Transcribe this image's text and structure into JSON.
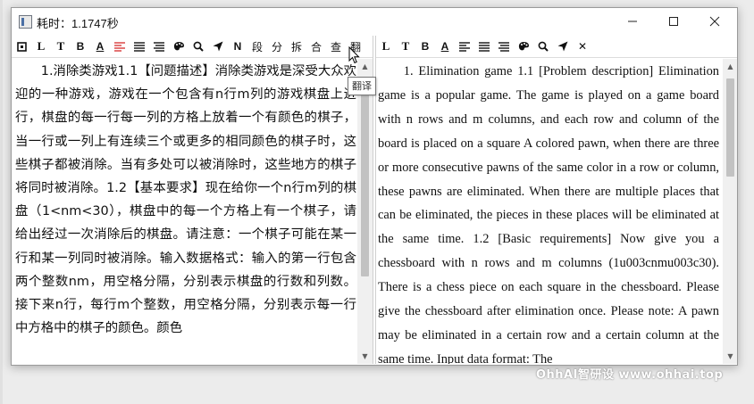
{
  "window": {
    "title": "耗时：1.1747秒"
  },
  "left_toolbar": {
    "items": [
      {
        "name": "frame-icon",
        "glyph": "⊡"
      },
      {
        "name": "text-l-icon",
        "glyph": "L"
      },
      {
        "name": "text-t-icon",
        "glyph": "T"
      },
      {
        "name": "bold-icon",
        "glyph": "B"
      },
      {
        "name": "underline-a-icon",
        "glyph": "A"
      },
      {
        "name": "align-red-icon",
        "glyph": ""
      },
      {
        "name": "align-justify-icon",
        "glyph": ""
      },
      {
        "name": "align-left-icon",
        "glyph": ""
      },
      {
        "name": "palette-icon",
        "glyph": ""
      },
      {
        "name": "search-icon",
        "glyph": ""
      },
      {
        "name": "send-icon",
        "glyph": ""
      },
      {
        "name": "n-icon",
        "glyph": "N"
      },
      {
        "name": "paragraph-button",
        "glyph": "段"
      },
      {
        "name": "split-button",
        "glyph": "分"
      },
      {
        "name": "break-button",
        "glyph": "拆"
      },
      {
        "name": "merge-button",
        "glyph": "合"
      },
      {
        "name": "check-button",
        "glyph": "查"
      },
      {
        "name": "translate-button",
        "glyph": "翻"
      }
    ]
  },
  "right_toolbar": {
    "items": [
      {
        "name": "text-l-icon",
        "glyph": "L"
      },
      {
        "name": "text-t-icon",
        "glyph": "T"
      },
      {
        "name": "bold-icon",
        "glyph": "B"
      },
      {
        "name": "underline-a-icon",
        "glyph": "A"
      },
      {
        "name": "align-justify-icon",
        "glyph": ""
      },
      {
        "name": "align-justify-2-icon",
        "glyph": ""
      },
      {
        "name": "align-left-icon",
        "glyph": ""
      },
      {
        "name": "palette-icon",
        "glyph": ""
      },
      {
        "name": "search-icon",
        "glyph": ""
      },
      {
        "name": "send-icon",
        "glyph": ""
      },
      {
        "name": "close-icon",
        "glyph": "✕"
      }
    ]
  },
  "tooltip": "翻译",
  "left_text": "1.消除类游戏1.1【问题描述】消除类游戏是深受大众欢迎的一种游戏，游戏在一个包含有n行m列的游戏棋盘上进行，棋盘的每一行每一列的方格上放着一个有颜色的棋子，当一行或一列上有连续三个或更多的相同颜色的棋子时，这些棋子都被消除。当有多处可以被消除时，这些地方的棋子将同时被消除。1.2【基本要求】现在给你一个n行m列的棋盘（1<nm<30），棋盘中的每一个方格上有一个棋子，请给出经过一次消除后的棋盘。请注意：一个棋子可能在某一行和某一列同时被消除。输入数据格式：输入的第一行包含两个整数nm，用空格分隔，分别表示棋盘的行数和列数。接下来n行，每行m个整数，用空格分隔，分别表示每一行中方格中的棋子的颜色。颜色",
  "right_text": "1. Elimination game 1.1 [Problem description] Elimination game is a popular game. The game is played on a game board with n rows and m columns, and each row and column of the board is placed on a square A colored pawn, when there are three or more consecutive pawns of the same color in a row or column, these pawns are eliminated. When there are multiple places that can be eliminated, the pieces in these places will be eliminated at the same time. 1.2 [Basic requirements] Now give you a chessboard with n rows and m columns (1u003cnmu003c30). There is a chess piece on each square in the chessboard. Please give the chessboard after elimination once. Please note: A pawn may be eliminated in a certain row and a certain column at the same time. Input data format: The",
  "watermark": "OhhAI智研设 www.ohhai.top",
  "colors": {
    "accent_red": "#d93a3a",
    "scroll_thumb": "#c2c2c2"
  }
}
